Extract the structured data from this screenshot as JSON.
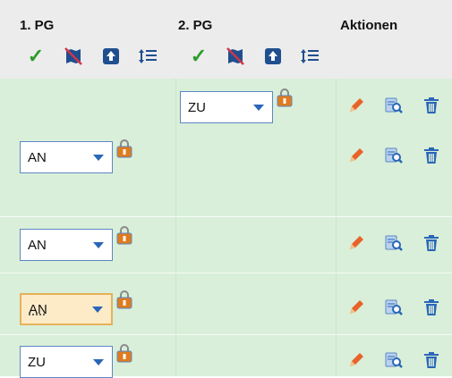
{
  "header": {
    "col1": "1. PG",
    "col2": "2. PG",
    "col3": "Aktionen",
    "icons": [
      "check-icon",
      "map-off-icon",
      "upload-icon",
      "sort-lines-icon"
    ]
  },
  "rows": [
    {
      "pg1": null,
      "pg2": "ZU"
    },
    {
      "pg1": "AN",
      "pg2": null
    },
    {
      "pg1": "AN",
      "pg2": null
    },
    {
      "pg1": "AN",
      "pg2": null,
      "focused": true
    },
    {
      "pg1": "ZU",
      "pg2": null
    }
  ],
  "actions": [
    "edit-icon",
    "view-details-icon",
    "delete-icon"
  ],
  "colors": {
    "accent": "#2a66b8",
    "rowBg": "#d9efd9",
    "headerBg": "#ececec",
    "check": "#2a9d2a",
    "edit": "#e8632a",
    "focus": "#fdebc8"
  }
}
